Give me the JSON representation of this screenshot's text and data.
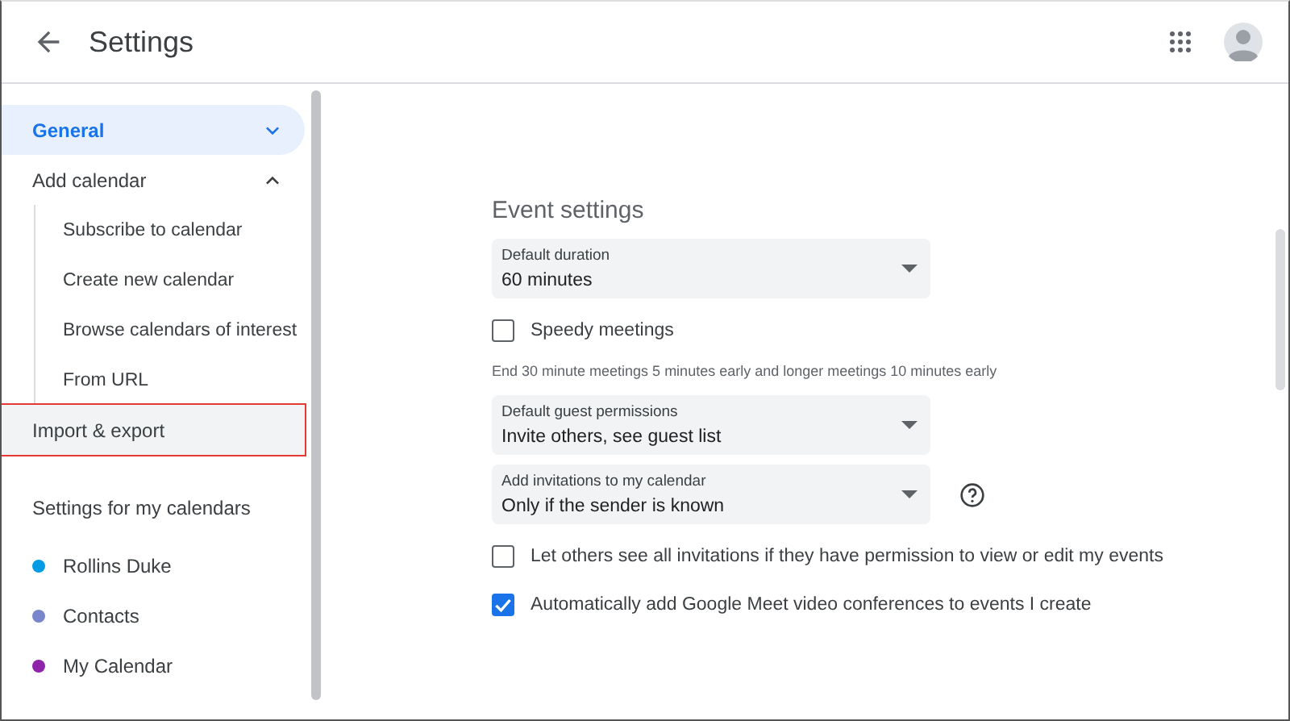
{
  "header": {
    "title": "Settings"
  },
  "sidebar": {
    "items": [
      {
        "label": "General",
        "selected": true,
        "outlined": false,
        "expanded": false
      },
      {
        "label": "Add calendar",
        "selected": false,
        "outlined": false,
        "expanded": true,
        "children": [
          {
            "label": "Subscribe to calendar"
          },
          {
            "label": "Create new calendar"
          },
          {
            "label": "Browse calendars of interest"
          },
          {
            "label": "From URL"
          }
        ]
      },
      {
        "label": "Import & export",
        "selected": false,
        "outlined": true
      }
    ],
    "calendars_heading": "Settings for my calendars",
    "calendars": [
      {
        "label": "Rollins Duke",
        "color": "#039be5"
      },
      {
        "label": "Contacts",
        "color": "#7986cb"
      },
      {
        "label": "My Calendar",
        "color": "#8e24aa"
      }
    ]
  },
  "content": {
    "section_title": "Event settings",
    "rows": [
      {
        "kind": "select",
        "label": "Default duration",
        "value": "60 minutes",
        "help": false
      },
      {
        "kind": "checkbox",
        "label": "Speedy meetings",
        "checked": false
      },
      {
        "kind": "note",
        "text": "End 30 minute meetings 5 minutes early and longer meetings 10 minutes early"
      },
      {
        "kind": "select",
        "label": "Default guest permissions",
        "value": "Invite others, see guest list",
        "help": false
      },
      {
        "kind": "select",
        "label": "Add invitations to my calendar",
        "value": "Only if the sender is known",
        "help": true
      },
      {
        "kind": "checkbox",
        "label": "Let others see all invitations if they have permission to view or edit my events",
        "checked": false
      },
      {
        "kind": "checkbox",
        "label": "Automatically add Google Meet video conferences to events I create",
        "checked": true
      }
    ]
  }
}
